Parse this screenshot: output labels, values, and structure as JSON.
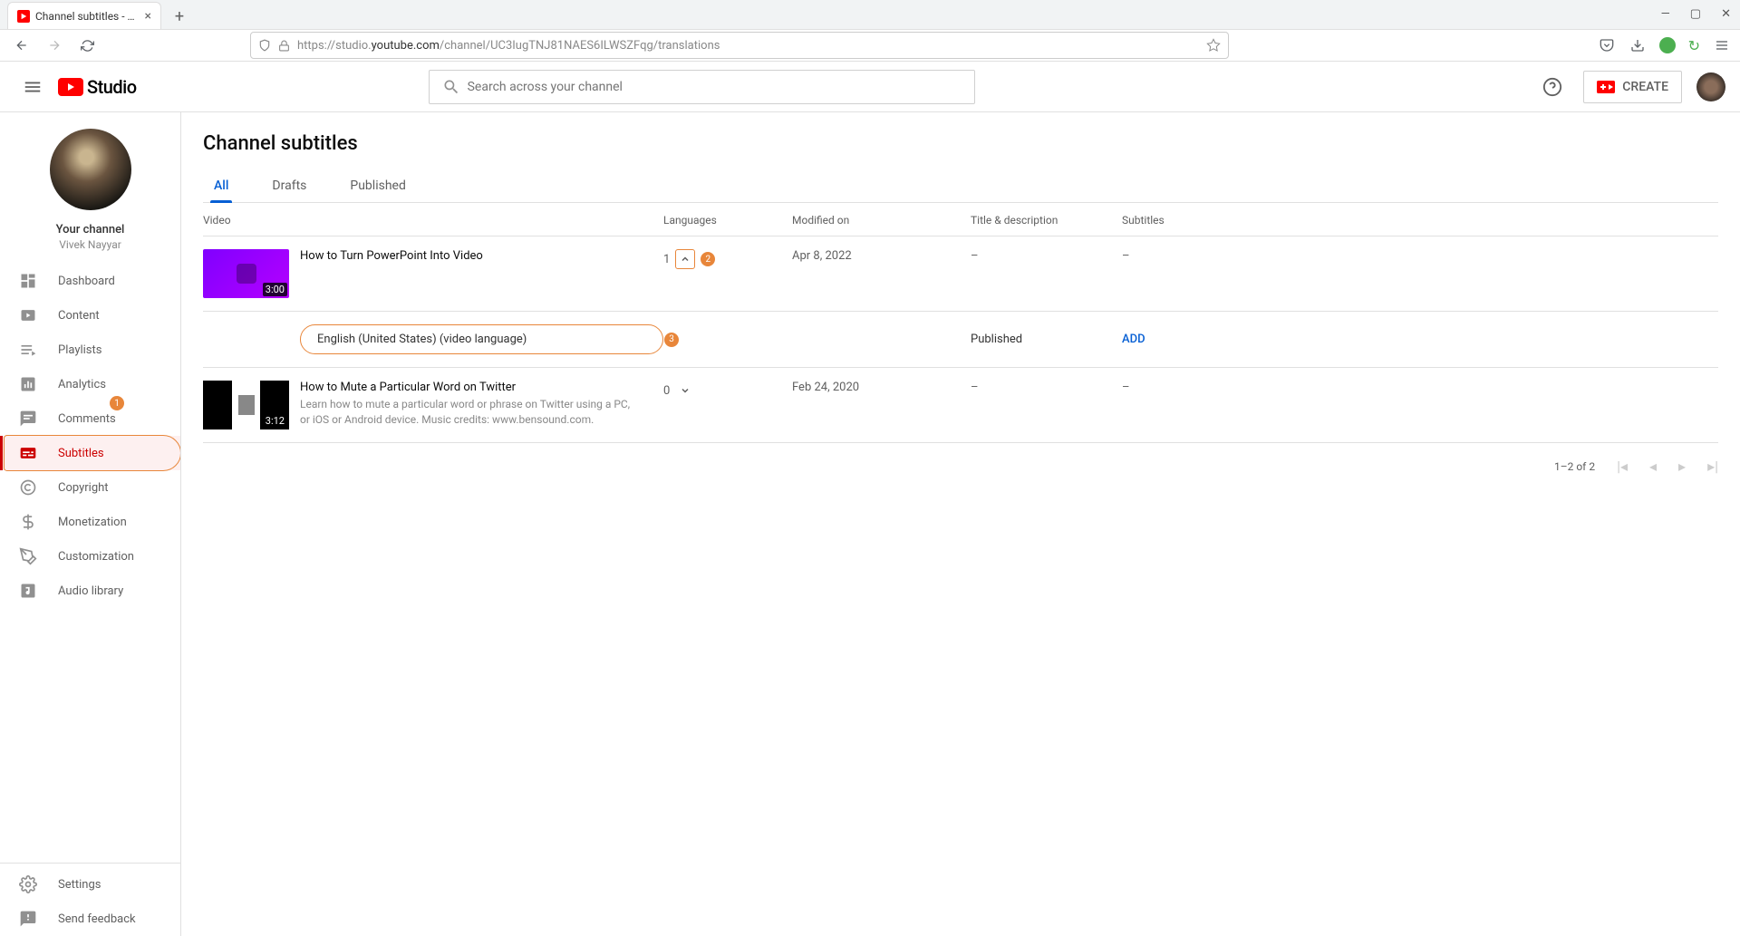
{
  "browser": {
    "tab_title": "Channel subtitles - YouTube St",
    "url_prefix": "https://studio.",
    "url_domain": "youtube.com",
    "url_path": "/channel/UC3IugTNJ81NAES6ILWSZFqg/translations"
  },
  "header": {
    "logo_text": "Studio",
    "search_placeholder": "Search across your channel",
    "create_label": "CREATE"
  },
  "sidebar": {
    "your_channel_label": "Your channel",
    "channel_name": "Vivek Nayyar",
    "items": [
      {
        "label": "Dashboard"
      },
      {
        "label": "Content"
      },
      {
        "label": "Playlists"
      },
      {
        "label": "Analytics"
      },
      {
        "label": "Comments"
      },
      {
        "label": "Subtitles"
      },
      {
        "label": "Copyright"
      },
      {
        "label": "Monetization"
      },
      {
        "label": "Customization"
      },
      {
        "label": "Audio library"
      }
    ],
    "bottom": [
      {
        "label": "Settings"
      },
      {
        "label": "Send feedback"
      }
    ]
  },
  "main": {
    "page_title": "Channel subtitles",
    "tabs": [
      {
        "label": "All"
      },
      {
        "label": "Drafts"
      },
      {
        "label": "Published"
      }
    ],
    "columns": {
      "video": "Video",
      "languages": "Languages",
      "modified": "Modified on",
      "titledesc": "Title & description",
      "subtitles": "Subtitles"
    },
    "rows": [
      {
        "title": "How to Turn PowerPoint Into Video",
        "duration": "3:00",
        "lang_count": "1",
        "modified": "Apr 8, 2022",
        "title_desc": "–",
        "subtitles": "–"
      },
      {
        "title": "How to Mute a Particular Word on Twitter",
        "description": "Learn how to mute a particular word or phrase on Twitter using a PC, or iOS or Android device. Music credits: www.bensound.com.",
        "duration": "3:12",
        "lang_count": "0",
        "modified": "Feb 24, 2020",
        "title_desc": "–",
        "subtitles": "–"
      }
    ],
    "language_row": {
      "label": "English (United States) (video language)",
      "status": "Published",
      "add": "ADD"
    },
    "pagination": {
      "range": "1–2 of 2"
    }
  },
  "annotations": {
    "b1": "1",
    "b2": "2",
    "b3": "3"
  }
}
